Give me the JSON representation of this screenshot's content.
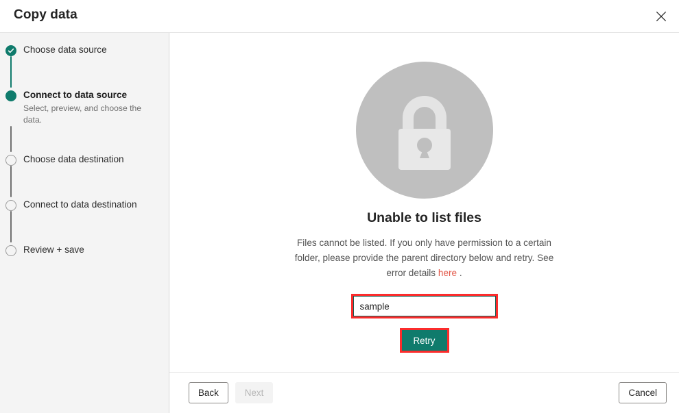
{
  "window": {
    "title": "Copy data",
    "close_icon": "close-icon"
  },
  "sidebar": {
    "steps": [
      {
        "label": "Choose data source",
        "sub": "",
        "state": "done",
        "marker_icon": "check-icon"
      },
      {
        "label": "Connect to data source",
        "sub": "Select, preview, and choose the data.",
        "state": "current",
        "marker_icon": "filled-circle-icon"
      },
      {
        "label": "Choose data destination",
        "sub": "",
        "state": "todo",
        "marker_icon": "empty-circle-icon"
      },
      {
        "label": "Connect to data destination",
        "sub": "",
        "state": "todo",
        "marker_icon": "empty-circle-icon"
      },
      {
        "label": "Review + save",
        "sub": "",
        "state": "todo",
        "marker_icon": "empty-circle-icon"
      }
    ]
  },
  "content": {
    "illustration_icon": "lock-icon",
    "error_title": "Unable to list files",
    "error_text_before_link": "Files cannot be listed. If you only have permission to a certain folder, please provide the parent directory below and retry. See error details ",
    "error_link_label": "here",
    "error_text_after_link": " .",
    "directory_input": {
      "value": "sample",
      "placeholder": ""
    },
    "retry_label": "Retry"
  },
  "footer": {
    "back_label": "Back",
    "next_label": "Next",
    "next_disabled": true,
    "cancel_label": "Cancel"
  },
  "colors": {
    "accent_teal": "#0f7b6c",
    "annotation_red": "#fb2c2c",
    "link_red": "#e2594a",
    "sidebar_bg": "#f4f4f4",
    "illustration_gray": "#bfbfbf"
  }
}
